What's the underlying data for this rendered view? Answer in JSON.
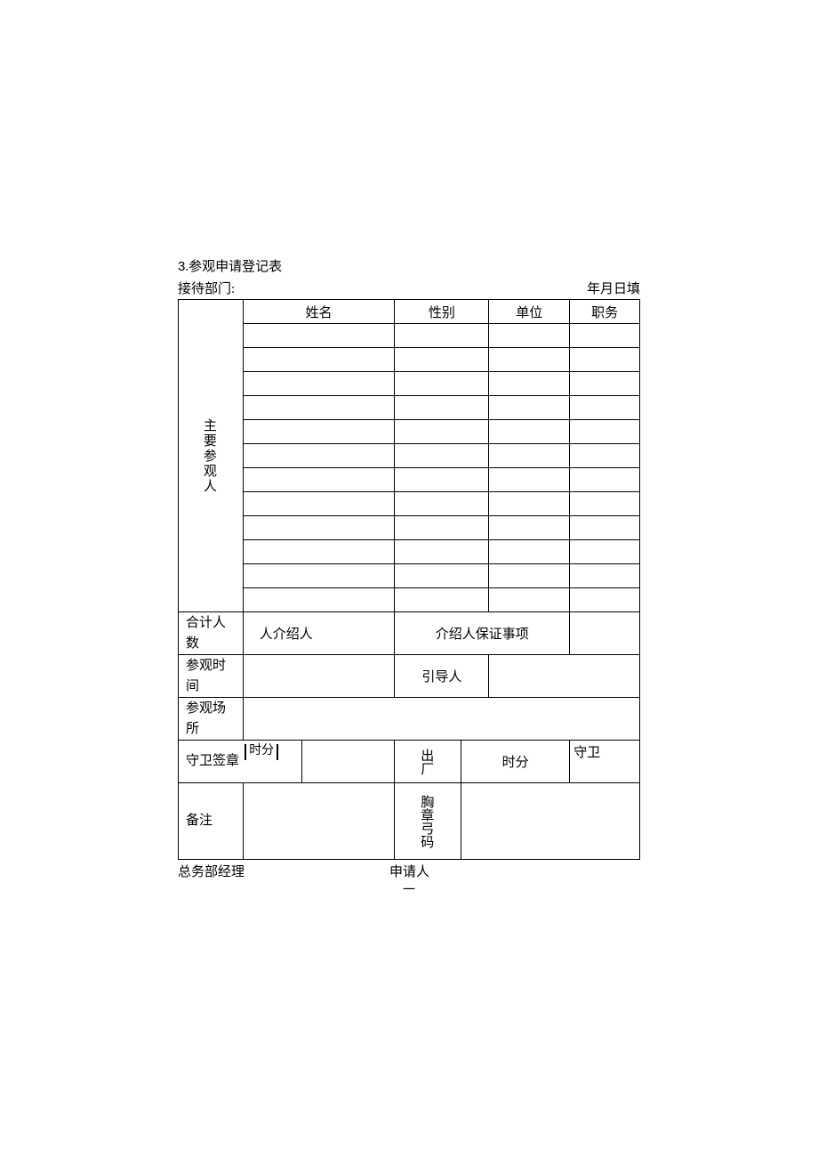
{
  "heading": {
    "number": "3",
    "sep": ".",
    "title": "参观申请登记表"
  },
  "header_left": "接待部门:",
  "header_right": "年月日填",
  "side_label": "主要参观人",
  "columns": {
    "name": "姓名",
    "gender": "性别",
    "unit": "单位",
    "position": "职务"
  },
  "rows": {
    "total_label": "合计人数",
    "total_cell1": "人介绍人",
    "total_cell2": "介绍人保证事项",
    "visit_time_label": "参观时间",
    "guide_label": "引导人",
    "visit_place_label": "参观场所",
    "guard_sign_label": "守卫签章",
    "time_hm1": "时分",
    "exit_factory": "出厂",
    "time_hm2": "时分",
    "guard": "守卫",
    "remarks_label": "备注",
    "badge_code": "胸章弓码"
  },
  "footer": {
    "left": "总务部经理",
    "right": "申请人",
    "dash": "一"
  }
}
